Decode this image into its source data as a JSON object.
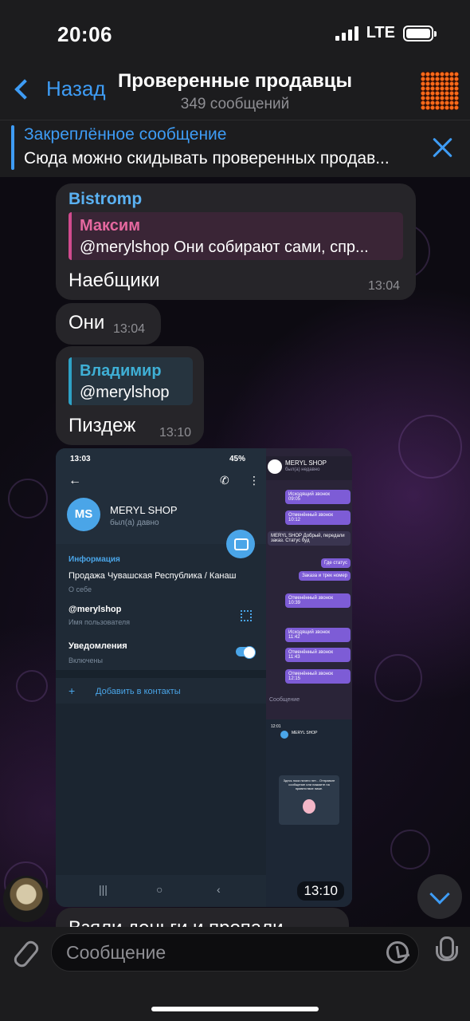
{
  "status": {
    "time": "20:06",
    "network": "LTE"
  },
  "header": {
    "back_label": "Назад",
    "title": "Проверенные продавцы",
    "subtitle": "349 сообщений"
  },
  "pinned": {
    "title": "Закреплённое сообщение",
    "text": "Сюда можно скидывать проверенных продав..."
  },
  "messages": [
    {
      "sender": "Bistromp",
      "reply_name": "Максим",
      "reply_text": "@merylshop Они собирают сами, спр...",
      "text": "Наебщики",
      "time": "13:04"
    },
    {
      "text": "Они",
      "time": "13:04"
    },
    {
      "reply_name": "Владимир",
      "reply_text": "@merylshop",
      "text": "Пиздеж",
      "time": "13:10"
    },
    {
      "media_time": "13:10",
      "screenshot": {
        "status_time": "13:03",
        "status_battery": "45%",
        "avatar_initials": "MS",
        "name": "MERYL SHOP",
        "seen": "был(а) давно",
        "info_title": "Информация",
        "bio": "Продажа Чувашская Республика / Канаш",
        "bio_label": "О себе",
        "username": "@merylshop",
        "username_label": "Имя пользователя",
        "notifications": "Уведомления",
        "notifications_state": "Включены",
        "add_contact": "Добавить в контакты",
        "right_name": "MERYL SHOP",
        "right_seen": "был(а) недавно",
        "right_msgs": [
          {
            "text": "Исходящий звонок",
            "time": "09:05"
          },
          {
            "text": "Отменённый звонок",
            "time": "10:12"
          },
          {
            "text": "Где статус",
            "time": ""
          },
          {
            "text": "Заказа и трек номер",
            "time": ""
          },
          {
            "text": "Отменённый звонок",
            "time": "10:39"
          },
          {
            "text": "Исходящий звонок",
            "time": "11:42"
          },
          {
            "text": "Отменённый звонок",
            "time": "11:43"
          },
          {
            "text": "Отменённый звонок",
            "time": "12:15"
          }
        ],
        "right_incoming": "MERYL SHOP Добрый, передали заказ. Статус буд",
        "right_input": "Сообщение",
        "mini_name": "MERYL SHOP",
        "mini_time": "12:01",
        "mini_text": "Здесь пока ничего нет... Отправьте сообщение или нажмите на приветствие ниже."
      }
    },
    {
      "text": "Взяли деньги и пропали"
    }
  ],
  "composer": {
    "placeholder": "Сообщение"
  }
}
